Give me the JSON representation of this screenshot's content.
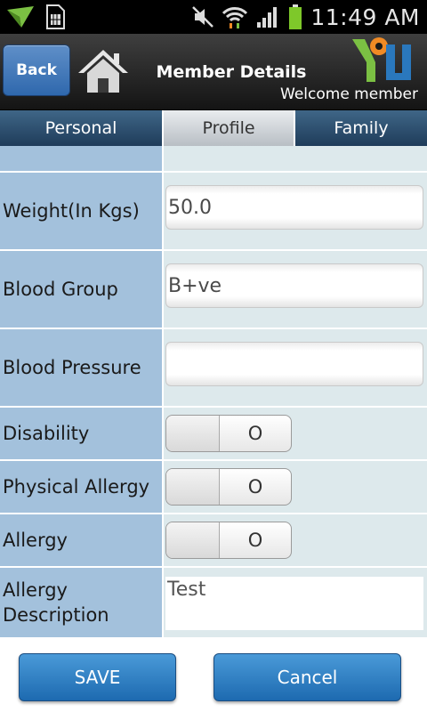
{
  "statusbar": {
    "time": "11:49 AM",
    "icons": [
      "notification-arrow-icon",
      "sim-card-icon",
      "mute-icon",
      "wifi-icon",
      "signal-icon",
      "battery-icon"
    ]
  },
  "header": {
    "back_label": "Back",
    "title": "Member Details",
    "welcome": "Welcome member",
    "home_icon": "home-icon",
    "logo": "app-logo"
  },
  "tabs": [
    {
      "label": "Personal",
      "active": false
    },
    {
      "label": "Profile",
      "active": true
    },
    {
      "label": "Family",
      "active": false
    }
  ],
  "form": {
    "weight": {
      "label": "Weight(In Kgs)",
      "value": "50.0"
    },
    "blood_group": {
      "label": "Blood Group",
      "value": "B+ve"
    },
    "blood_pressure": {
      "label": "Blood Pressure",
      "value": ""
    },
    "disability": {
      "label": "Disability",
      "value": "O"
    },
    "physical_allergy": {
      "label": "Physical Allergy",
      "value": "O"
    },
    "allergy": {
      "label": "Allergy",
      "value": "O"
    },
    "allergy_description": {
      "label_line1": "Allergy",
      "label_line2": "Description",
      "value": "Test"
    }
  },
  "buttons": {
    "save": "SAVE",
    "cancel": "Cancel"
  },
  "colors": {
    "label_bg": "#a3c1dc",
    "cell_bg": "#dde9ec",
    "button_blue": "#2a78bd",
    "tab_dark": "#2d4c6b"
  }
}
